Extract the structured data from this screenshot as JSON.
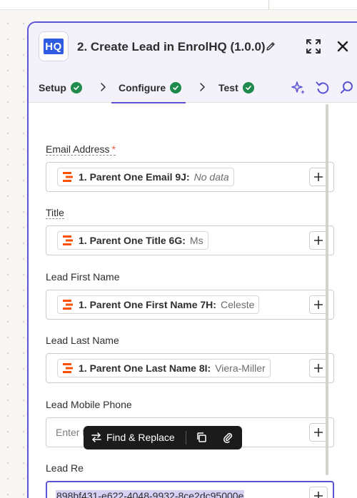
{
  "header": {
    "app_logo_text": "HQ",
    "title": "2. Create Lead in EnrolHQ (1.0.0)"
  },
  "tabs": [
    {
      "label": "Setup",
      "status": "complete"
    },
    {
      "label": "Configure",
      "status": "complete",
      "active": true
    },
    {
      "label": "Test",
      "status": "complete"
    }
  ],
  "fields": {
    "email": {
      "label": "Email Address",
      "required_mark": "*",
      "token_label": "1. Parent One Email 9J:",
      "token_value": "No data"
    },
    "title": {
      "label": "Title",
      "token_label": "1. Parent One Title 6G:",
      "token_value": "Ms"
    },
    "first_name": {
      "label": "Lead First Name",
      "token_label": "1. Parent One First Name 7H:",
      "token_value": "Celeste"
    },
    "last_name": {
      "label": "Lead Last Name",
      "token_label": "1. Parent One Last Name 8I:",
      "token_value": "Viera-Miller"
    },
    "mobile": {
      "label": "Lead Mobile Phone",
      "placeholder": "Enter text or insert data..."
    },
    "reference": {
      "label": "Lead Re",
      "value": "898bf431-e622-4048-9932-8ce2dc95000e"
    }
  },
  "floating_toolbar": {
    "find_replace_label": "Find & Replace"
  },
  "colors": {
    "accent": "#5b55d6",
    "success": "#1f8a4c",
    "zapier_orange": "#ff4f00",
    "required": "#e5573f"
  }
}
